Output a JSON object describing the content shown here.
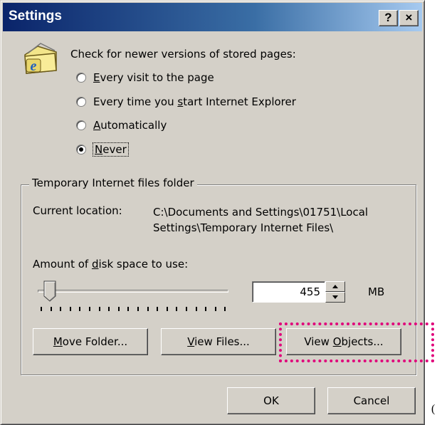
{
  "window": {
    "title": "Settings",
    "help_label": "?",
    "close_label": "×"
  },
  "check": {
    "label": "Check for newer versions of stored pages:",
    "options": [
      {
        "prefix": "",
        "accel": "E",
        "rest": "very visit to the page",
        "checked": false
      },
      {
        "prefix": "Every time you ",
        "accel": "s",
        "rest": "tart Internet Explorer",
        "checked": false
      },
      {
        "prefix": "",
        "accel": "A",
        "rest": "utomatically",
        "checked": false
      },
      {
        "prefix": "",
        "accel": "N",
        "rest": "ever",
        "checked": true
      }
    ]
  },
  "temp_folder": {
    "legend": "Temporary Internet files folder",
    "current_location_label": "Current location:",
    "current_location_line1": "C:\\Documents and Settings\\01751\\Local",
    "current_location_line2": "Settings\\Temporary Internet Files\\",
    "amount_prefix": "Amount of ",
    "amount_accel": "d",
    "amount_rest": "isk space to use:",
    "disk_space_value": "455",
    "disk_space_unit": "MB",
    "slider_fraction": 0.03
  },
  "buttons": {
    "move_folder": {
      "accel": "M",
      "rest": "ove Folder..."
    },
    "view_files": {
      "accel": "V",
      "rest": "iew Files..."
    },
    "view_objects": {
      "prefix": "View ",
      "accel": "O",
      "rest": "bjects..."
    },
    "ok": "OK",
    "cancel": "Cancel"
  },
  "annotation": {
    "highlight_color": "#e0007a",
    "corner_glyph": "("
  },
  "icons": [
    "internet-explorer-folder-icon",
    "spin-up-icon",
    "spin-down-icon",
    "slider-thumb-icon"
  ]
}
